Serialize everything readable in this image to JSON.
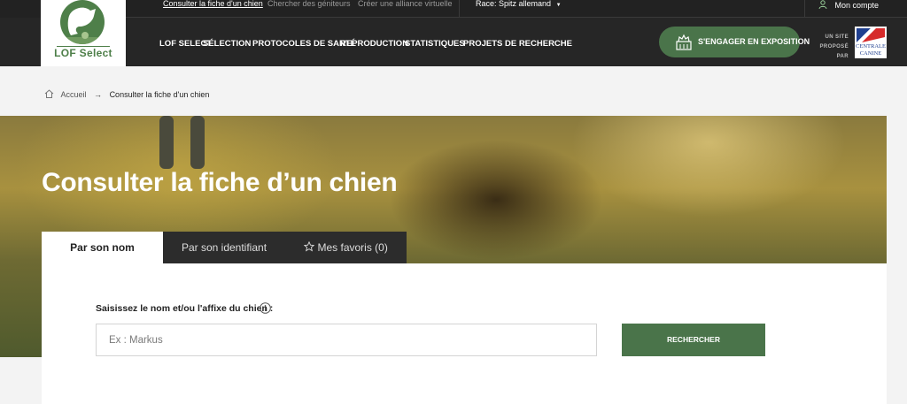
{
  "topbar": {
    "links": [
      {
        "label": "Consulter la fiche d'un chien",
        "active": true
      },
      {
        "label": "Chercher des géniteurs",
        "active": false
      },
      {
        "label": "Créer une alliance virtuelle",
        "active": false
      }
    ],
    "race_selector": "Race: Spitz allemand",
    "account_label": "Mon compte"
  },
  "logo": {
    "text": "LOF Select"
  },
  "nav": {
    "items": [
      "LOF SELECT",
      "SÉLECTION",
      "PROTOCOLES DE SANTÉ",
      "REPRODUCTION",
      "STATISTIQUES",
      "PROJETS DE RECHERCHE"
    ]
  },
  "cta": {
    "label": "S'ENGAGER EN EXPOSITION"
  },
  "partner": {
    "line1": "UN SITE",
    "line2": "PROPOSÉ PAR",
    "logo_line1": "CENTRALE",
    "logo_line2": "CANINE"
  },
  "breadcrumb": {
    "home": "Accueil",
    "arrow": "→",
    "current": "Consulter la fiche d'un chien"
  },
  "hero": {
    "title": "Consulter la fiche d’un chien"
  },
  "tabs": [
    {
      "label": "Par son nom",
      "active": true
    },
    {
      "label": "Par son identifiant",
      "active": false
    },
    {
      "label": "Mes favoris (0)",
      "active": false
    }
  ],
  "search": {
    "label": "Saisissez le nom et/ou l'affixe du chien :",
    "placeholder": "Ex : Markus",
    "value": "",
    "button": "RECHERCHER"
  },
  "colors": {
    "brand_green": "#4a744a",
    "header_dark": "#262626"
  }
}
